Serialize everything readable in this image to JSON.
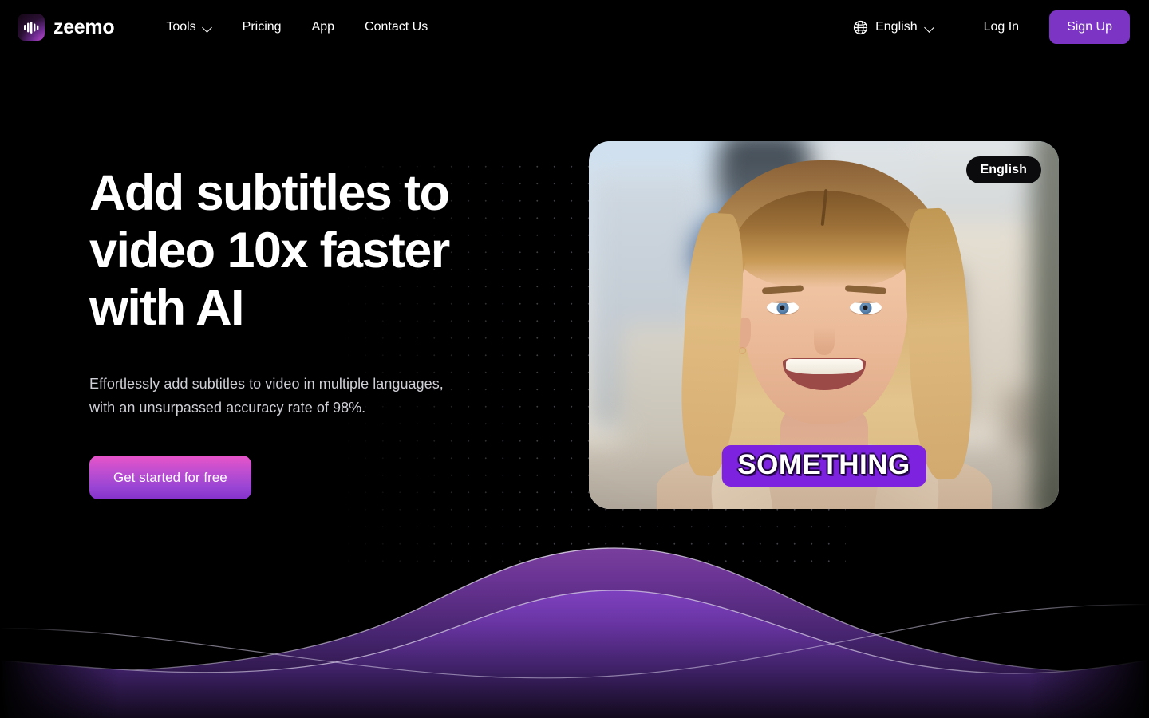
{
  "brand": {
    "name": "zeemo",
    "logo_icon": "waveform-icon",
    "logo_gradient_from": "#120513",
    "logo_gradient_to": "#ef63d8"
  },
  "header": {
    "nav": [
      {
        "label": "Tools",
        "has_dropdown": true,
        "icon": "chevron-down-icon"
      },
      {
        "label": "Pricing",
        "has_dropdown": false
      },
      {
        "label": "App",
        "has_dropdown": false
      },
      {
        "label": "Contact Us",
        "has_dropdown": false
      }
    ],
    "language": {
      "icon": "globe-icon",
      "value": "English",
      "chevron": "chevron-down-icon"
    },
    "login_label": "Log In",
    "signup_label": "Sign Up",
    "signup_color": "#7c34c4"
  },
  "hero": {
    "title": "Add subtitles to\nvideo 10x faster\nwith AI",
    "subtitle": "Effortlessly add subtitles to video in multiple languages,\nwith an unsurpassed accuracy rate of 98%.",
    "cta_label": "Get started for free",
    "cta_gradient_from": "#e854c8",
    "cta_gradient_to": "#8431cc"
  },
  "video_card": {
    "language_badge": "English",
    "subtitle_caption": "SOMETHING",
    "subtitle_chip_color": "#7d23e0",
    "scene_description": "smiling blonde woman in beige coat with blurred city background"
  },
  "waves": {
    "primary_color": "#5b2d8e",
    "secondary_color": "#4a2478",
    "stroke_color": "#b9a6c9"
  }
}
